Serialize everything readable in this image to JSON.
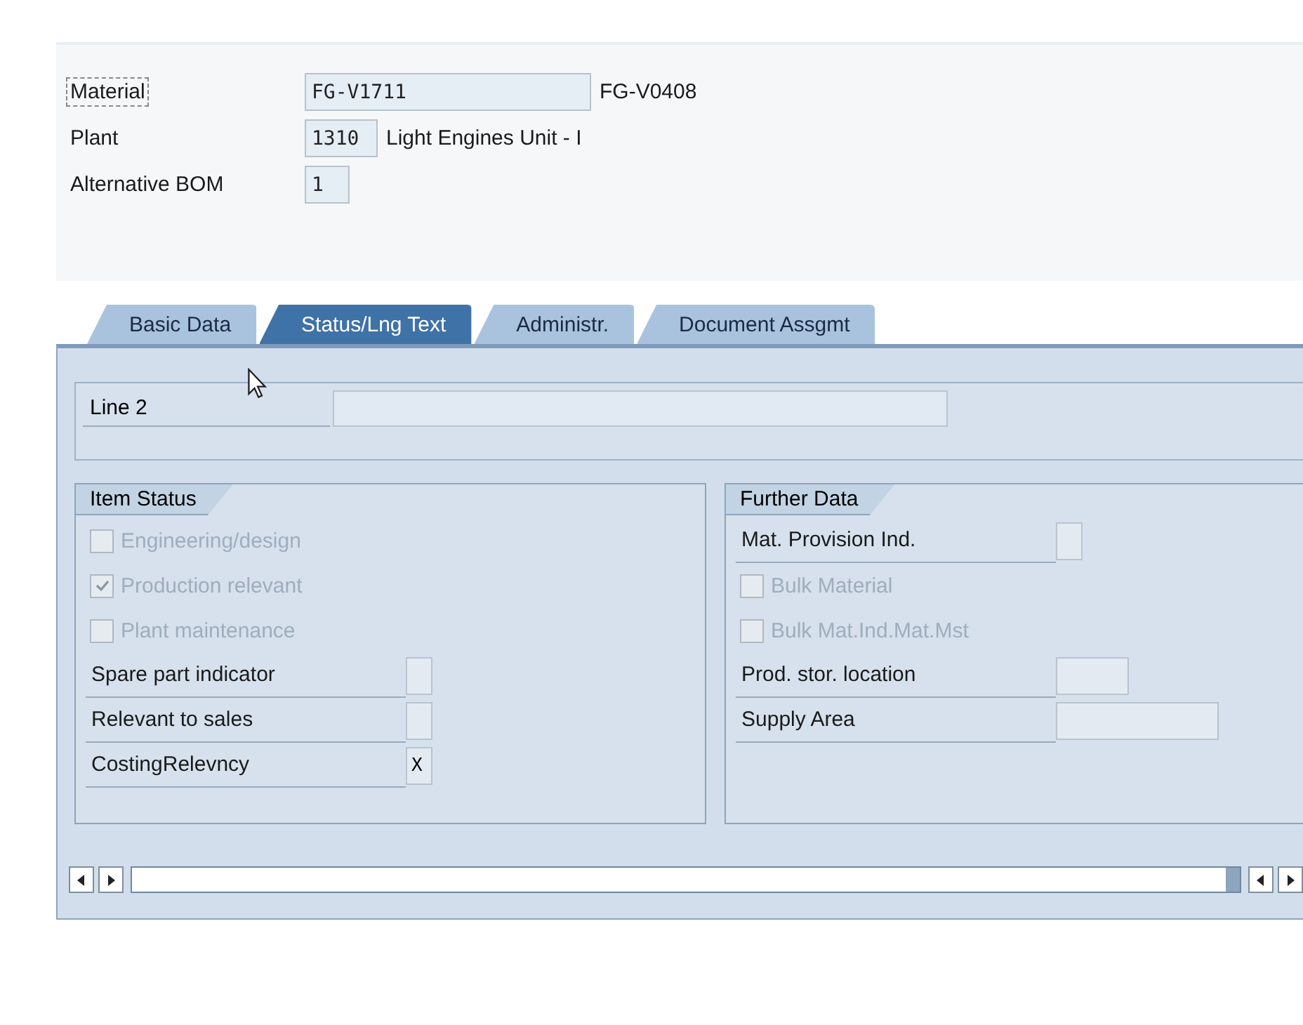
{
  "header_fields": [
    {
      "label": "Material",
      "focused": true,
      "value": "FG-V1711",
      "kind": "long",
      "description": "FG-V0408"
    },
    {
      "label": "Plant",
      "focused": false,
      "value": "1310",
      "kind": "short",
      "description": "Light Engines Unit - I"
    },
    {
      "label": "Alternative BOM",
      "focused": false,
      "value": "1",
      "kind": "tiny"
    }
  ],
  "tabs": [
    {
      "label": "Basic Data",
      "selected": false
    },
    {
      "label": "Status/Lng Text",
      "selected": true
    },
    {
      "label": "Administr.",
      "selected": false
    },
    {
      "label": "Document Assgmt",
      "selected": false
    }
  ],
  "line_2": {
    "label": "Line 2"
  },
  "groups": [
    {
      "title": "Item Status",
      "items": [
        {
          "kind": "checkbox",
          "label": "Engineering/design",
          "checked": false,
          "disabled": true
        },
        {
          "kind": "checkbox",
          "label": "Production relevant",
          "checked": true,
          "disabled": true
        },
        {
          "kind": "checkbox",
          "label": "Plant maintenance",
          "checked": false,
          "disabled": true
        },
        {
          "kind": "indicator",
          "label": "Spare part indicator"
        },
        {
          "kind": "indicator",
          "label": "Relevant to sales"
        },
        {
          "kind": "indicator",
          "label": "CostingRelevncy",
          "value": "X"
        }
      ]
    },
    {
      "title": "Further Data",
      "items": [
        {
          "kind": "indicator",
          "label": "Mat. Provision Ind."
        },
        {
          "kind": "checkbox",
          "label": "Bulk Material",
          "checked": false,
          "disabled": true
        },
        {
          "kind": "checkbox",
          "label": "Bulk Mat.Ind.Mat.Mst",
          "checked": false,
          "disabled": true
        },
        {
          "kind": "medium-field",
          "label": "Prod. stor. location"
        },
        {
          "kind": "wide-field",
          "label": "Supply Area"
        }
      ]
    }
  ]
}
